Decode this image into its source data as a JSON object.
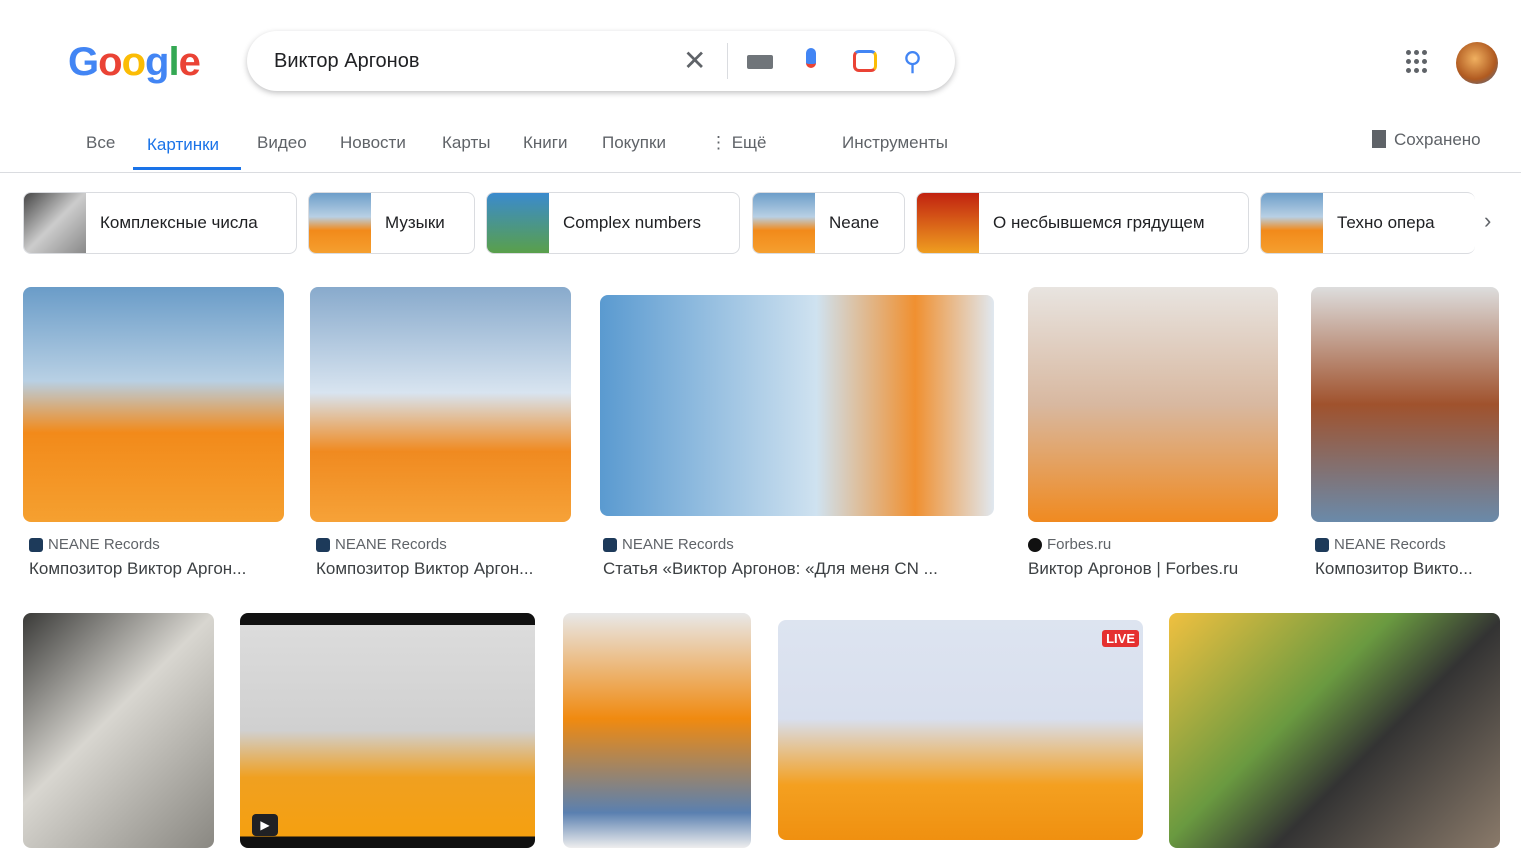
{
  "header": {
    "logo": "Google",
    "query": "Виктор Аргонов",
    "icons": [
      "close-icon",
      "keyboard-icon",
      "mic-icon",
      "lens-icon",
      "search-icon",
      "apps-icon",
      "avatar"
    ]
  },
  "tabs": [
    {
      "label": "Все"
    },
    {
      "label": "Картинки",
      "active": true
    },
    {
      "label": "Видео"
    },
    {
      "label": "Новости"
    },
    {
      "label": "Карты"
    },
    {
      "label": "Книги"
    },
    {
      "label": "Покупки"
    },
    {
      "label": "⋮ Ещё"
    }
  ],
  "tools": "Инструменты",
  "saved": "Сохранено",
  "chips": [
    "Комплексные числа",
    "Музыки",
    "Complex numbers",
    "Neane",
    "О несбывшемся грядущем",
    "Техно опера"
  ],
  "results": [
    {
      "source": "NEANE Records",
      "title": "Композитор Виктор Аргон..."
    },
    {
      "source": "NEANE Records",
      "title": "Композитор Виктор Аргон..."
    },
    {
      "source": "NEANE Records",
      "title": "Статья «Виктор Аргонов: «Для меня CN ..."
    },
    {
      "source": "Forbes.ru",
      "title": "Виктор Аргонов | Forbes.ru"
    },
    {
      "source": "NEANE Records",
      "title": "Композитор Викто..."
    }
  ],
  "row2_badges": {
    "live": "LIVE"
  },
  "colors": {
    "accent": "#1a73e8"
  }
}
